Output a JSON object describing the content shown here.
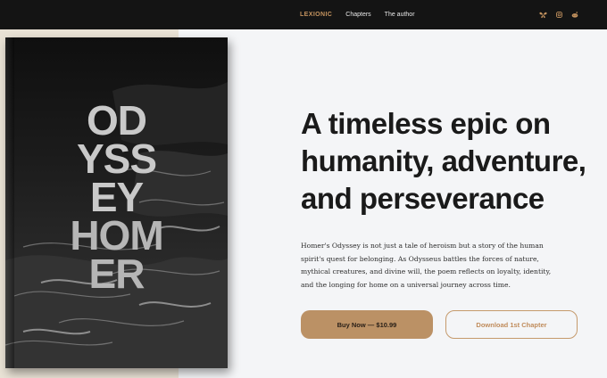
{
  "nav": {
    "brand": "LEXIONIC",
    "links": [
      "Chapters",
      "The author"
    ],
    "social_icons": [
      "butterfly-icon",
      "instagram-icon",
      "reddit-icon"
    ]
  },
  "cover": {
    "title_lines": [
      "OD",
      "YSS",
      "EY",
      "HOM",
      "ER"
    ]
  },
  "hero": {
    "headline_lines": [
      "A timeless epic on",
      "humanity, adventure,",
      "and perseverance"
    ],
    "description_lines": [
      "Homer's Odyssey is not just a tale of heroism but a story of the human",
      "spirit's quest for belonging. As Odysseus battles the forces of nature,",
      "mythical creatures, and divine will, the poem reflects on loyalty, identity,",
      "and the longing for home on a universal journey across time."
    ]
  },
  "buttons": {
    "buy": "Buy Now — $10.99",
    "download": "Download 1st Chapter"
  },
  "colors": {
    "accent": "#bb9165",
    "nav_bg": "#141414",
    "page_bg": "#f4f5f7",
    "beige_panel": "#e9e2d5"
  }
}
